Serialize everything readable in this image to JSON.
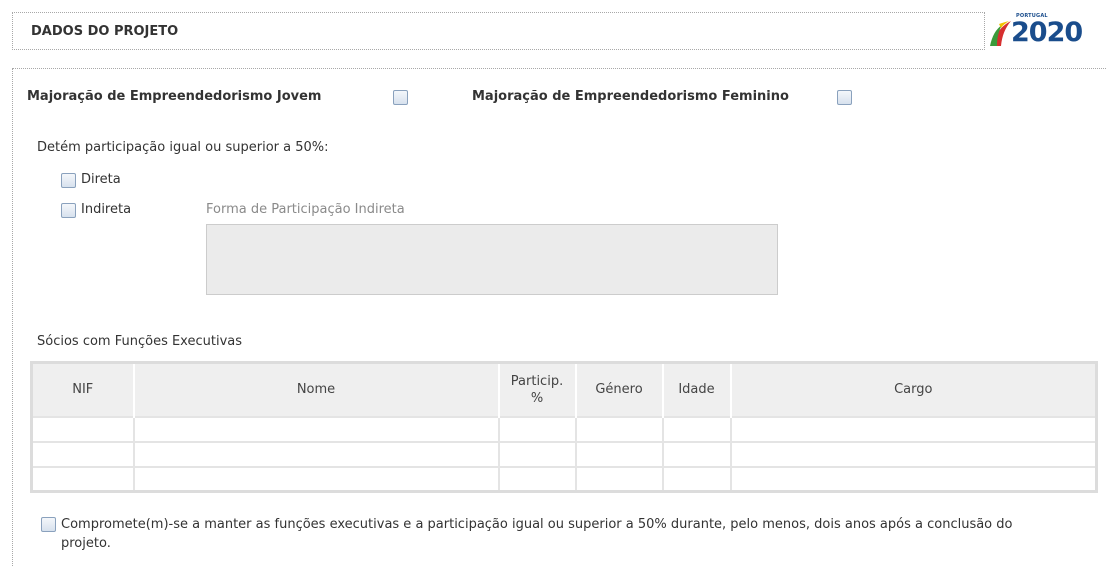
{
  "header": {
    "title": "DADOS DO PROJETO"
  },
  "logo": {
    "top_text": "PORTUGAL",
    "main_text": "2020"
  },
  "majoracao": {
    "jovem_label": "Majoração de Empreendedorismo Jovem",
    "feminino_label": "Majoração de Empreendedorismo Feminino"
  },
  "participacao": {
    "question": "Detém participação igual ou superior a 50%:",
    "direta_label": "Direta",
    "indireta_label": "Indireta",
    "forma_label": "Forma de Participação Indireta",
    "forma_value": ""
  },
  "socios": {
    "title": "Sócios com Funções Executivas",
    "columns": [
      "NIF",
      "Nome",
      "Particip.\n%",
      "Género",
      "Idade",
      "Cargo"
    ],
    "rows": [
      [
        "",
        "",
        "",
        "",
        "",
        ""
      ],
      [
        "",
        "",
        "",
        "",
        "",
        ""
      ],
      [
        "",
        "",
        "",
        "",
        "",
        ""
      ]
    ]
  },
  "compromisso": {
    "line1": "Compromete(m)-se a manter as funções executivas e a participação igual ou superior a 50% durante, pelo menos, dois anos após a conclusão do",
    "line2": "projeto."
  },
  "colors": {
    "logo_blue": "#1a4d8c",
    "logo_green": "#3a9a3a",
    "logo_red": "#d62f2f",
    "logo_yellow": "#f2c200"
  }
}
